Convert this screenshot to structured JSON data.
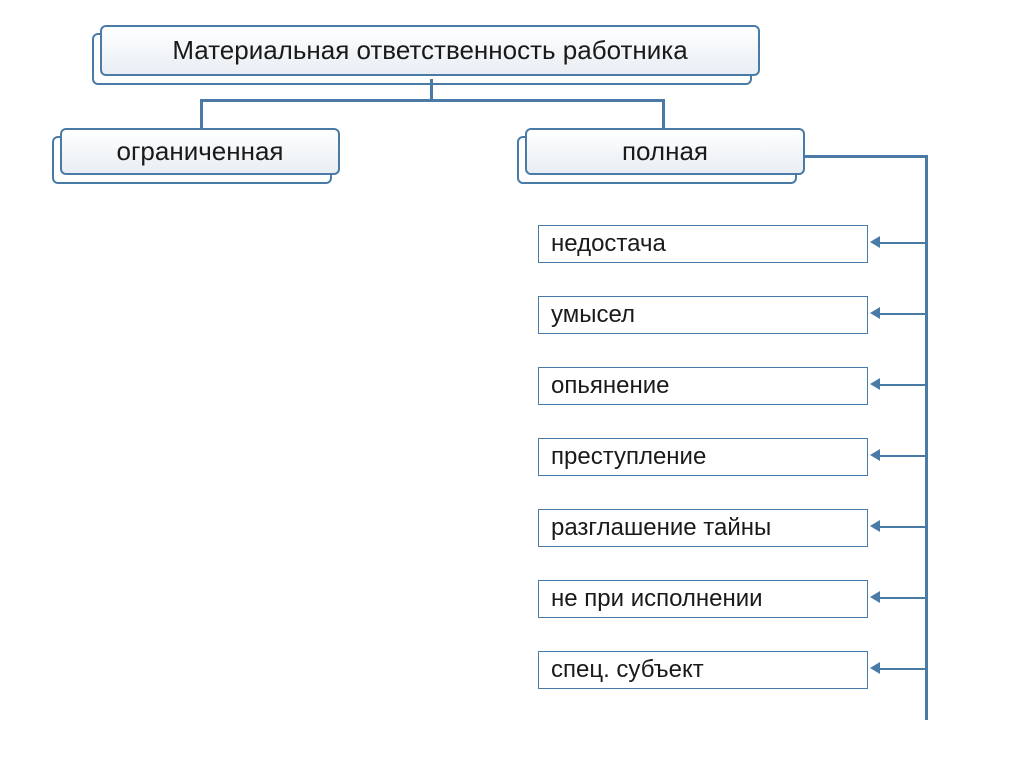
{
  "root": {
    "label": "Материальная ответственность работника"
  },
  "branches": {
    "limited": {
      "label": "ограниченная"
    },
    "full": {
      "label": "полная"
    }
  },
  "full_items": [
    "недостача",
    "умысел",
    "опьянение",
    "преступление",
    "разглашение тайны",
    "не при исполнении",
    "спец. субъект"
  ]
}
